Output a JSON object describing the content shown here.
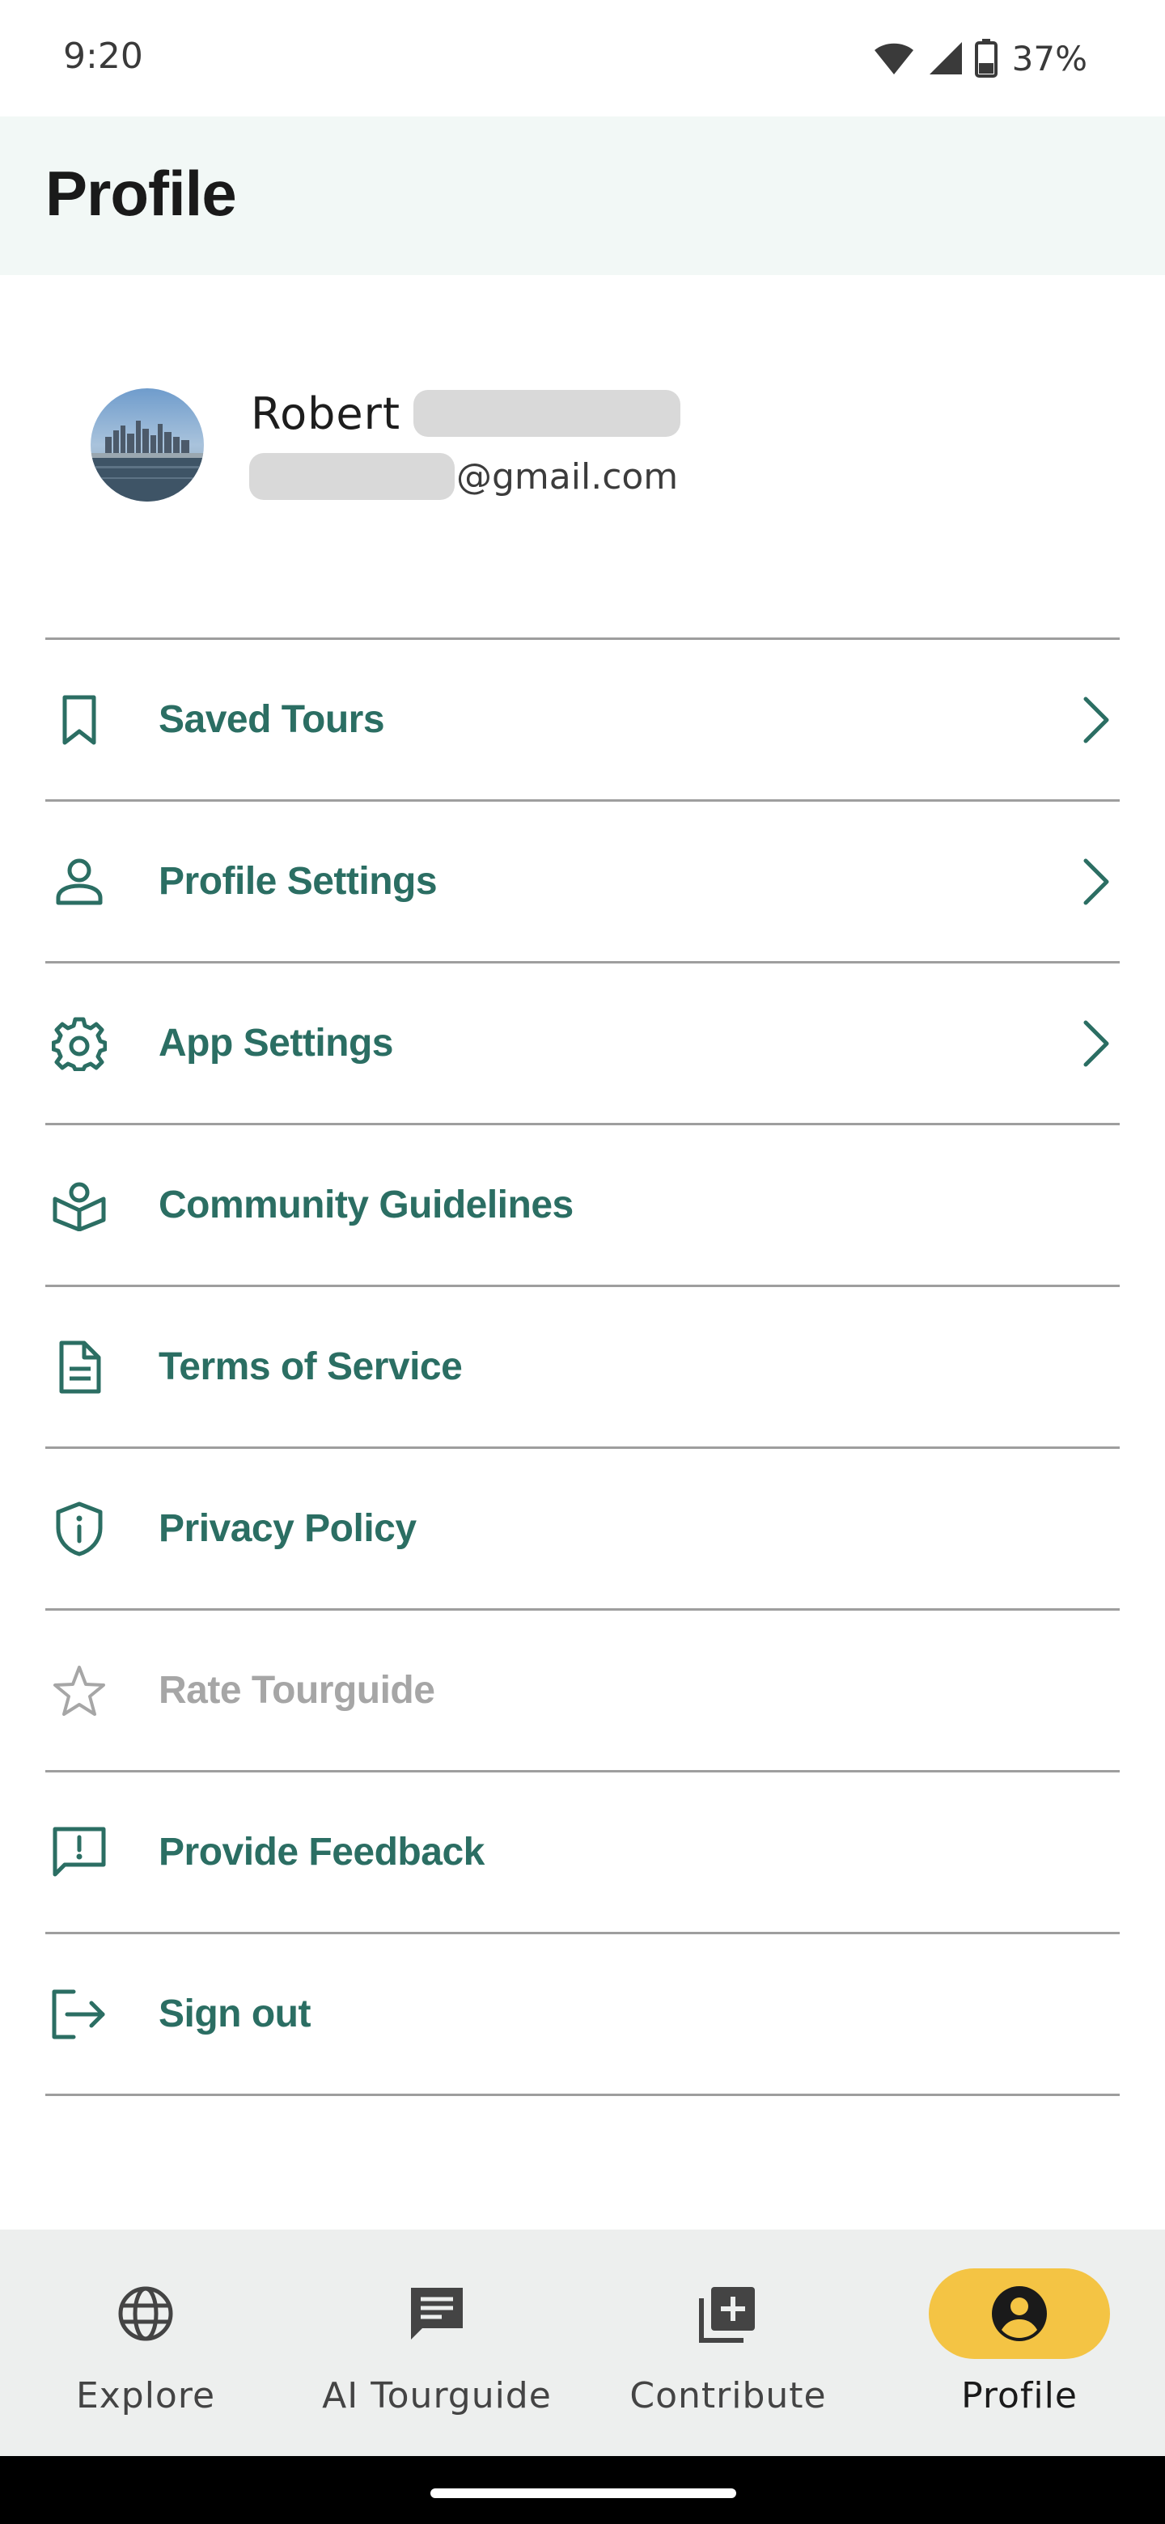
{
  "status_bar": {
    "time": "9:20",
    "battery_percent": "37%",
    "icons": [
      "wifi-icon",
      "signal-icon",
      "battery-icon"
    ]
  },
  "app_bar": {
    "title": "Profile"
  },
  "user": {
    "first_name": "Robert",
    "email_domain": "@gmail.com"
  },
  "menu": {
    "items": [
      {
        "label": "Saved Tours",
        "icon": "bookmark-icon",
        "chevron": true,
        "enabled": true
      },
      {
        "label": "Profile Settings",
        "icon": "person-icon",
        "chevron": true,
        "enabled": true
      },
      {
        "label": "App Settings",
        "icon": "gear-icon",
        "chevron": true,
        "enabled": true
      },
      {
        "label": "Community Guidelines",
        "icon": "open-book-icon",
        "chevron": false,
        "enabled": true
      },
      {
        "label": "Terms of Service",
        "icon": "document-icon",
        "chevron": false,
        "enabled": true
      },
      {
        "label": "Privacy Policy",
        "icon": "shield-info-icon",
        "chevron": false,
        "enabled": true
      },
      {
        "label": "Rate Tourguide",
        "icon": "star-icon",
        "chevron": false,
        "enabled": false
      },
      {
        "label": "Provide Feedback",
        "icon": "feedback-icon",
        "chevron": false,
        "enabled": true
      },
      {
        "label": "Sign out",
        "icon": "sign-out-icon",
        "chevron": false,
        "enabled": true
      }
    ]
  },
  "bottom_nav": {
    "items": [
      {
        "label": "Explore",
        "icon": "globe-icon",
        "active": false
      },
      {
        "label": "AI Tourguide",
        "icon": "chat-icon",
        "active": false
      },
      {
        "label": "Contribute",
        "icon": "add-box-icon",
        "active": false
      },
      {
        "label": "Profile",
        "icon": "account-circle-icon",
        "active": true
      }
    ]
  },
  "colors": {
    "accent": "#2b6e63",
    "app_bar_bg": "#f2f8f6",
    "active_nav_pill": "#f4c444",
    "disabled_text": "#a6a6a6",
    "divider": "#9e9e9e",
    "nav_bg": "#edefee"
  }
}
